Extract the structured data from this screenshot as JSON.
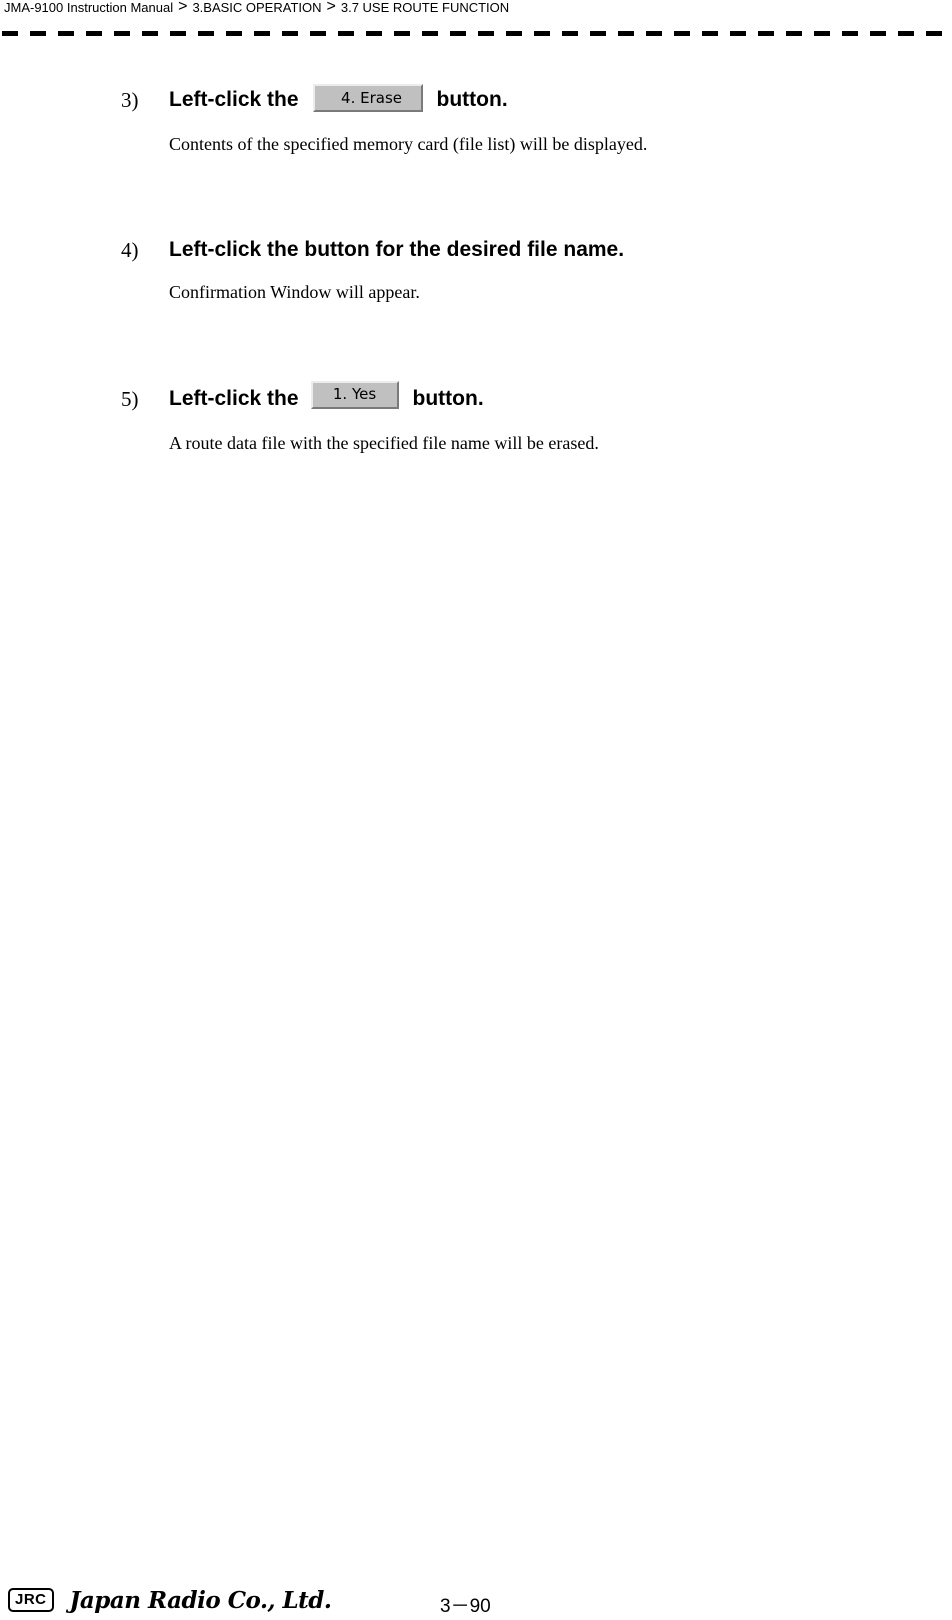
{
  "header": {
    "breadcrumb": [
      "JMA-9100 Instruction Manual",
      "3.BASIC OPERATION",
      "3.7  USE ROUTE FUNCTION"
    ],
    "separator": ">"
  },
  "steps": [
    {
      "number": "3)",
      "title_before": "Left-click the",
      "button_label": "4. Erase",
      "title_after": "button.",
      "description": "Contents of the specified memory card (file list) will be displayed."
    },
    {
      "number": "4)",
      "title": "Left-click the button for the desired file name.",
      "description": "Confirmation Window will appear."
    },
    {
      "number": "5)",
      "title_before": "Left-click the",
      "button_label": "1. Yes",
      "title_after": "button.",
      "description": "A route data file with the specified file name will be erased."
    }
  ],
  "footer": {
    "logo_text": "JRC",
    "company": "Japan Radio Co., Ltd.",
    "page_number": "3－90"
  }
}
